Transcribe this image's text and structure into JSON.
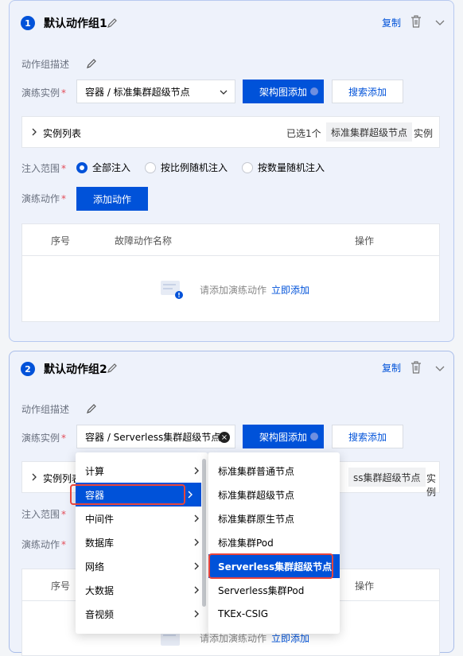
{
  "groups": [
    {
      "number": "1",
      "title": "默认动作组1",
      "copy_label": "复制",
      "description_label": "动作组描述",
      "instance_label": "演练实例",
      "instance_value": "容器 / 标准集群超级节点",
      "arch_add_label": "架构图添加",
      "search_add_label": "搜索添加",
      "instance_list_label": "实例列表",
      "selected_count": "已选1个",
      "selected_tag": "标准集群超级节点",
      "selected_suffix": "实例",
      "scope_label": "注入范围",
      "scope_options": [
        "全部注入",
        "按比例随机注入",
        "按数量随机注入"
      ],
      "scope_selected": 0,
      "action_label": "演练动作",
      "add_action_label": "添加动作",
      "table_headers": [
        "序号",
        "故障动作名称",
        "操作"
      ],
      "empty_text": "请添加演练动作",
      "empty_link": "立即添加"
    },
    {
      "number": "2",
      "title": "默认动作组2",
      "copy_label": "复制",
      "description_label": "动作组描述",
      "instance_label": "演练实例",
      "instance_value": "容器 / Serverless集群超级节点",
      "arch_add_label": "架构图添加",
      "search_add_label": "搜索添加",
      "instance_list_label": "实例列表",
      "selected_tag_partial": "ss集群超级节点",
      "selected_suffix": "实例",
      "scope_label": "注入范围",
      "action_label": "演练动作",
      "table_headers": [
        "序号",
        "操作"
      ],
      "empty_text_partial": "请添加演练动作",
      "empty_link": "立即添加"
    }
  ],
  "cascader": {
    "level1": [
      "计算",
      "容器",
      "中间件",
      "数据库",
      "网络",
      "大数据",
      "音视频"
    ],
    "level1_selected": "容器",
    "level2": [
      "标准集群普通节点",
      "标准集群超级节点",
      "标准集群原生节点",
      "标准集群Pod",
      "Serverless集群超级节点",
      "Serverless集群Pod",
      "TKEx-CSIG"
    ],
    "level2_selected": "Serverless集群超级节点"
  },
  "colors": {
    "primary": "#0052d9",
    "required": "#e34d59",
    "highlight_border": "#e8453c"
  }
}
